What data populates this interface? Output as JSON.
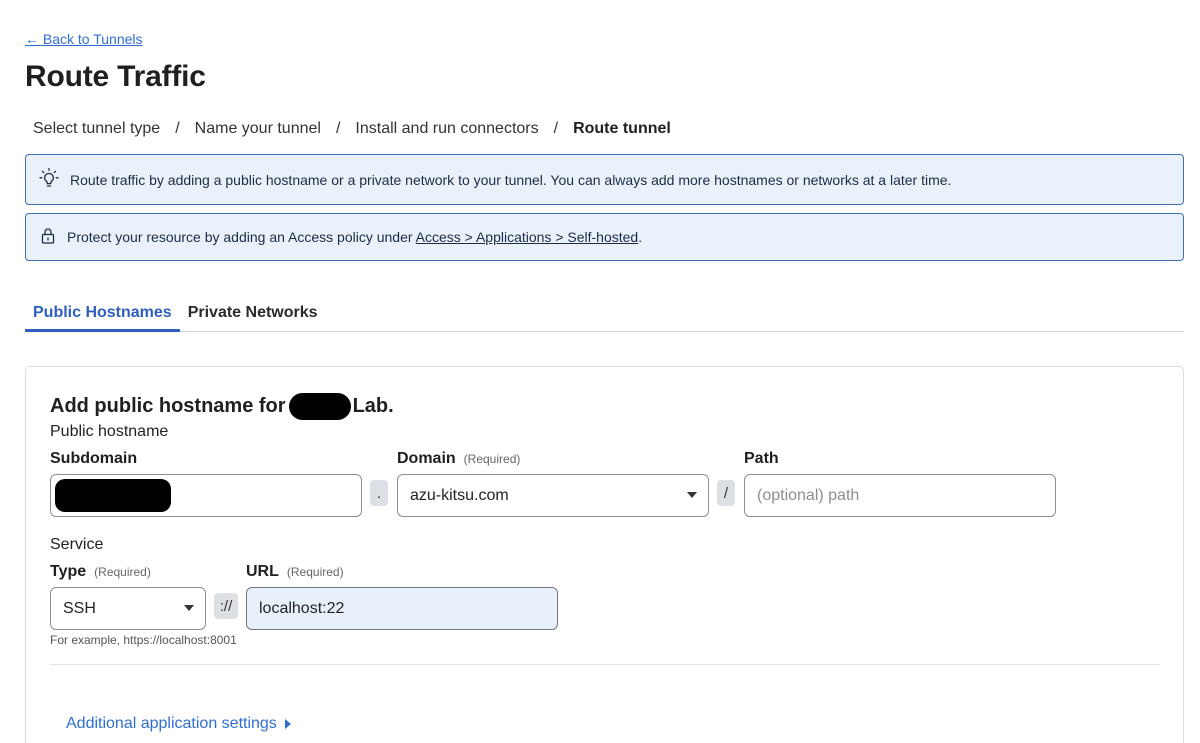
{
  "nav": {
    "back_label": "← Back to Tunnels"
  },
  "page": {
    "title": "Route Traffic"
  },
  "steps": [
    {
      "label": "Select tunnel type"
    },
    {
      "label": "Name your tunnel"
    },
    {
      "label": "Install and run connectors"
    },
    {
      "label": "Route tunnel"
    }
  ],
  "step_separator": "/",
  "banners": {
    "tip": {
      "icon": "lightbulb-icon",
      "text": "Route traffic by adding a public hostname or a private network to your tunnel. You can always add more hostnames or networks at a later time."
    },
    "access": {
      "icon": "lock-icon",
      "prefix": "Protect your resource by adding an Access policy under ",
      "link": "Access > Applications > Self-hosted",
      "suffix": "."
    }
  },
  "tabs": [
    {
      "label": "Public Hostnames",
      "active": true
    },
    {
      "label": "Private Networks",
      "active": false
    }
  ],
  "form": {
    "title_prefix": "Add public hostname for",
    "title_suffix": "Lab.",
    "public_hostname_label": "Public hostname",
    "subdomain": {
      "label": "Subdomain"
    },
    "dot": ".",
    "domain": {
      "label": "Domain",
      "required": "(Required)",
      "value": "azu-kitsu.com"
    },
    "slash": "/",
    "path": {
      "label": "Path",
      "placeholder": "(optional) path"
    },
    "service_label": "Service",
    "type": {
      "label": "Type",
      "required": "(Required)",
      "value": "SSH"
    },
    "scheme_sep": "://",
    "url": {
      "label": "URL",
      "required": "(Required)",
      "value": "localhost:22"
    },
    "hint": "For example, https://localhost:8001",
    "additional_settings": "Additional application settings"
  },
  "colors": {
    "accent": "#2f5fbf",
    "link": "#2f6fd1",
    "banner_bg": "#eaf1fb",
    "banner_border": "#3e6fb8"
  }
}
